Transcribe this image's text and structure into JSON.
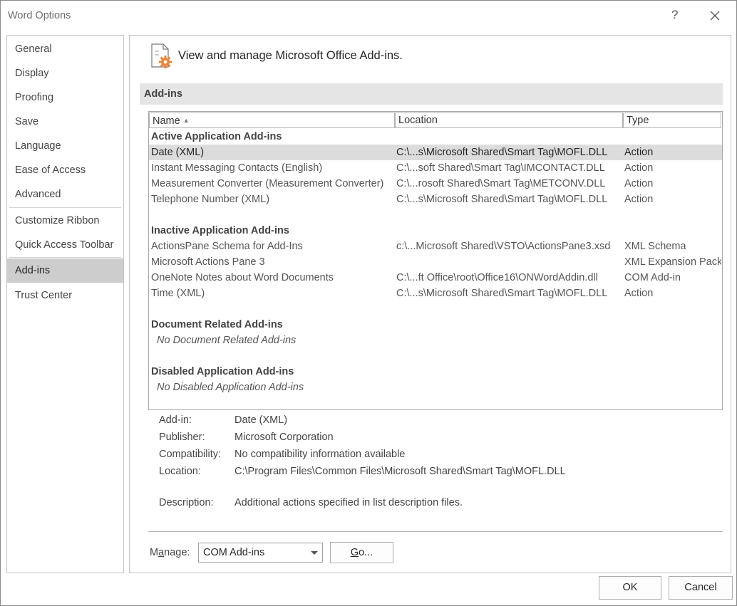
{
  "window": {
    "title": "Word Options",
    "help_glyph": "?"
  },
  "sidebar": {
    "items": [
      {
        "label": "General"
      },
      {
        "label": "Display"
      },
      {
        "label": "Proofing"
      },
      {
        "label": "Save"
      },
      {
        "label": "Language"
      },
      {
        "label": "Ease of Access"
      },
      {
        "label": "Advanced"
      },
      {
        "label": "Customize Ribbon"
      },
      {
        "label": "Quick Access Toolbar"
      },
      {
        "label": "Add-ins",
        "selected": true
      },
      {
        "label": "Trust Center"
      }
    ]
  },
  "header": {
    "text": "View and manage Microsoft Office Add-ins."
  },
  "section": {
    "title": "Add-ins"
  },
  "list": {
    "columns": [
      "Name",
      "Location",
      "Type"
    ],
    "sort_glyph": "▲",
    "groups": {
      "active": {
        "title": "Active Application Add-ins",
        "rows": [
          {
            "name": "Date (XML)",
            "location": "C:\\...s\\Microsoft Shared\\Smart Tag\\MOFL.DLL",
            "type": "Action"
          },
          {
            "name": "Instant Messaging Contacts (English)",
            "location": "C:\\...soft Shared\\Smart Tag\\IMCONTACT.DLL",
            "type": "Action"
          },
          {
            "name": "Measurement Converter (Measurement Converter)",
            "location": "C:\\...rosoft Shared\\Smart Tag\\METCONV.DLL",
            "type": "Action"
          },
          {
            "name": "Telephone Number (XML)",
            "location": "C:\\...s\\Microsoft Shared\\Smart Tag\\MOFL.DLL",
            "type": "Action"
          }
        ]
      },
      "inactive": {
        "title": "Inactive Application Add-ins",
        "rows": [
          {
            "name": "ActionsPane Schema for Add-Ins",
            "location": "c:\\...Microsoft Shared\\VSTO\\ActionsPane3.xsd",
            "type": "XML Schema"
          },
          {
            "name": "Microsoft Actions Pane 3",
            "location": "",
            "type": "XML Expansion Pack"
          },
          {
            "name": "OneNote Notes about Word Documents",
            "location": "C:\\...ft Office\\root\\Office16\\ONWordAddin.dll",
            "type": "COM Add-in"
          },
          {
            "name": "Time (XML)",
            "location": "C:\\...s\\Microsoft Shared\\Smart Tag\\MOFL.DLL",
            "type": "Action"
          }
        ]
      },
      "document": {
        "title": "Document Related Add-ins",
        "empty": "No Document Related Add-ins"
      },
      "disabled": {
        "title": "Disabled Application Add-ins",
        "empty": "No Disabled Application Add-ins"
      }
    }
  },
  "details": {
    "addin_label": "Add-in:",
    "addin_value": "Date (XML)",
    "publisher_label": "Publisher:",
    "publisher_value": "Microsoft Corporation",
    "compat_label": "Compatibility:",
    "compat_value": "No compatibility information available",
    "location_label": "Location:",
    "location_value": "C:\\Program Files\\Common Files\\Microsoft Shared\\Smart Tag\\MOFL.DLL",
    "description_label": "Description:",
    "description_value": "Additional actions specified in list description files."
  },
  "manage": {
    "label_pre": "M",
    "label_ul": "a",
    "label_post": "nage:",
    "selected_value": "COM Add-ins",
    "go_ul": "G",
    "go_post": "o..."
  },
  "footer": {
    "ok_label": "OK",
    "cancel_label": "Cancel"
  },
  "colors": {
    "selected_bg": "#cdcdcd",
    "section_band": "#e5e5e5",
    "icon_accent": "#e8863a"
  }
}
